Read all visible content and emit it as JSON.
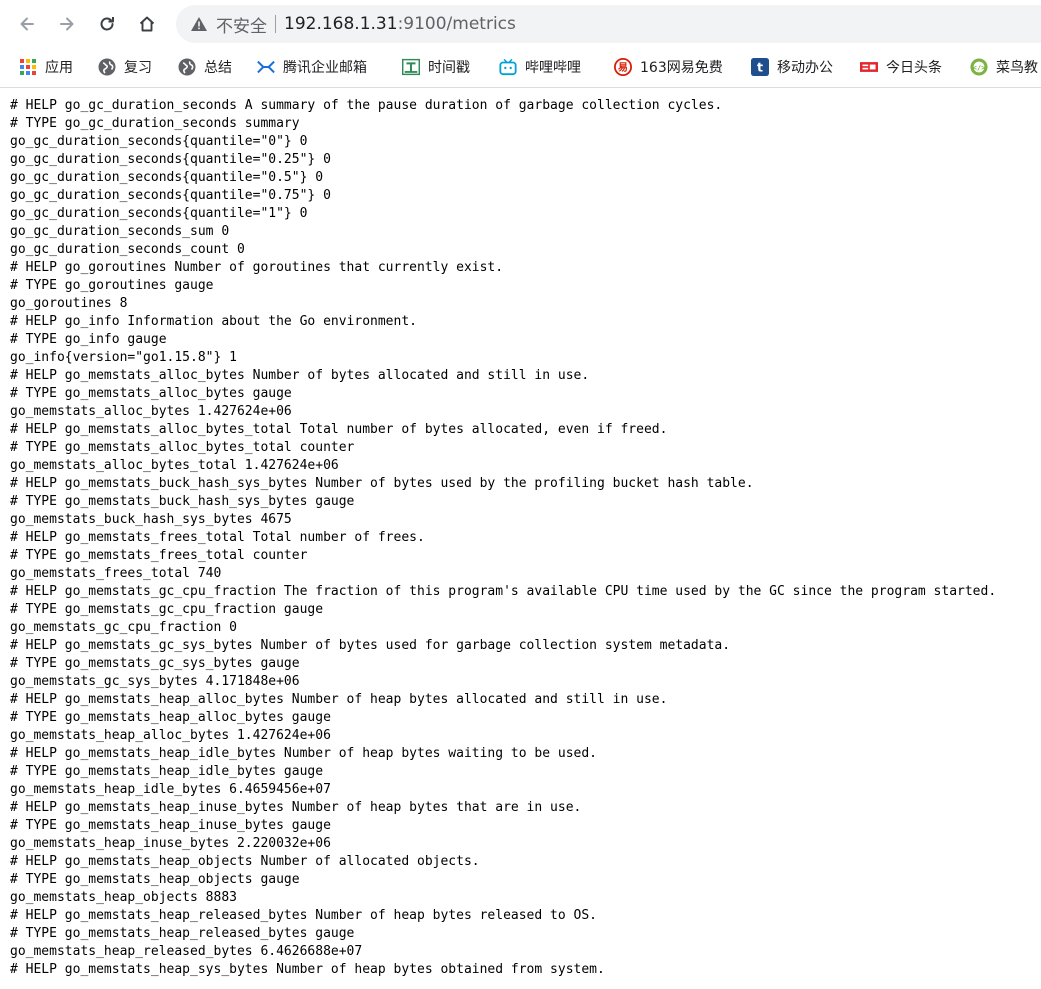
{
  "browser": {
    "security_label": "不安全",
    "url_host": "192.168.1.31",
    "url_path": ":9100/metrics",
    "bookmarks": [
      {
        "label": "应用",
        "icon": "apps-grid-icon"
      },
      {
        "label": "复习",
        "icon": "globe-icon"
      },
      {
        "label": "总结",
        "icon": "globe-icon"
      },
      {
        "label": "腾讯企业邮箱",
        "icon": "tencent-mail-icon"
      },
      {
        "label": "时间戳",
        "icon": "timestamp-icon"
      },
      {
        "label": "哔哩哔哩",
        "icon": "bilibili-icon"
      },
      {
        "label": "163网易免费",
        "icon": "netease-icon"
      },
      {
        "label": "移动办公",
        "icon": "t-icon"
      },
      {
        "label": "今日头条",
        "icon": "toutiao-icon"
      },
      {
        "label": "菜鸟教",
        "icon": "runoob-icon"
      }
    ]
  },
  "metrics_lines": [
    "# HELP go_gc_duration_seconds A summary of the pause duration of garbage collection cycles.",
    "# TYPE go_gc_duration_seconds summary",
    "go_gc_duration_seconds{quantile=\"0\"} 0",
    "go_gc_duration_seconds{quantile=\"0.25\"} 0",
    "go_gc_duration_seconds{quantile=\"0.5\"} 0",
    "go_gc_duration_seconds{quantile=\"0.75\"} 0",
    "go_gc_duration_seconds{quantile=\"1\"} 0",
    "go_gc_duration_seconds_sum 0",
    "go_gc_duration_seconds_count 0",
    "# HELP go_goroutines Number of goroutines that currently exist.",
    "# TYPE go_goroutines gauge",
    "go_goroutines 8",
    "# HELP go_info Information about the Go environment.",
    "# TYPE go_info gauge",
    "go_info{version=\"go1.15.8\"} 1",
    "# HELP go_memstats_alloc_bytes Number of bytes allocated and still in use.",
    "# TYPE go_memstats_alloc_bytes gauge",
    "go_memstats_alloc_bytes 1.427624e+06",
    "# HELP go_memstats_alloc_bytes_total Total number of bytes allocated, even if freed.",
    "# TYPE go_memstats_alloc_bytes_total counter",
    "go_memstats_alloc_bytes_total 1.427624e+06",
    "# HELP go_memstats_buck_hash_sys_bytes Number of bytes used by the profiling bucket hash table.",
    "# TYPE go_memstats_buck_hash_sys_bytes gauge",
    "go_memstats_buck_hash_sys_bytes 4675",
    "# HELP go_memstats_frees_total Total number of frees.",
    "# TYPE go_memstats_frees_total counter",
    "go_memstats_frees_total 740",
    "# HELP go_memstats_gc_cpu_fraction The fraction of this program's available CPU time used by the GC since the program started.",
    "# TYPE go_memstats_gc_cpu_fraction gauge",
    "go_memstats_gc_cpu_fraction 0",
    "# HELP go_memstats_gc_sys_bytes Number of bytes used for garbage collection system metadata.",
    "# TYPE go_memstats_gc_sys_bytes gauge",
    "go_memstats_gc_sys_bytes 4.171848e+06",
    "# HELP go_memstats_heap_alloc_bytes Number of heap bytes allocated and still in use.",
    "# TYPE go_memstats_heap_alloc_bytes gauge",
    "go_memstats_heap_alloc_bytes 1.427624e+06",
    "# HELP go_memstats_heap_idle_bytes Number of heap bytes waiting to be used.",
    "# TYPE go_memstats_heap_idle_bytes gauge",
    "go_memstats_heap_idle_bytes 6.4659456e+07",
    "# HELP go_memstats_heap_inuse_bytes Number of heap bytes that are in use.",
    "# TYPE go_memstats_heap_inuse_bytes gauge",
    "go_memstats_heap_inuse_bytes 2.220032e+06",
    "# HELP go_memstats_heap_objects Number of allocated objects.",
    "# TYPE go_memstats_heap_objects gauge",
    "go_memstats_heap_objects 8883",
    "# HELP go_memstats_heap_released_bytes Number of heap bytes released to OS.",
    "# TYPE go_memstats_heap_released_bytes gauge",
    "go_memstats_heap_released_bytes 6.4626688e+07",
    "# HELP go_memstats_heap_sys_bytes Number of heap bytes obtained from system."
  ]
}
